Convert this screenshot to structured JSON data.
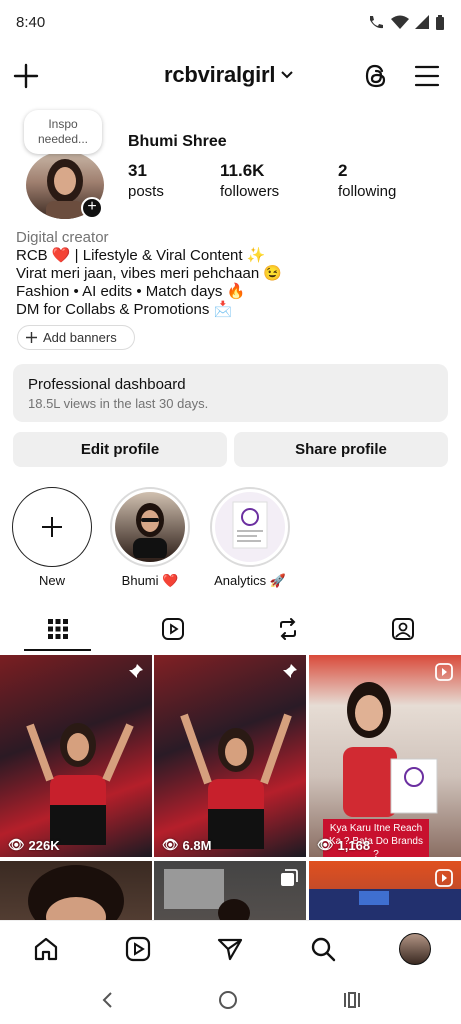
{
  "status_bar": {
    "time": "8:40"
  },
  "header": {
    "username": "rcbviralgirl"
  },
  "profile": {
    "note": "Inspo needed...",
    "display_name": "Bhumi Shree",
    "stats": [
      {
        "value": "31",
        "label": "posts"
      },
      {
        "value": "11.6K",
        "label": "followers"
      },
      {
        "value": "2",
        "label": "following"
      }
    ],
    "category": "Digital creator",
    "bio_lines": [
      "RCB ❤️ | Lifestyle & Viral Content ✨",
      "Virat meri jaan, vibes meri pehchaan 😉",
      "Fashion • AI edits • Match days 🔥",
      "DM for Collabs & Promotions 📩"
    ],
    "add_banners": "Add banners"
  },
  "dashboard": {
    "title": "Professional dashboard",
    "subtitle": "18.5L views in the last 30 days."
  },
  "buttons": {
    "edit": "Edit profile",
    "share": "Share profile"
  },
  "highlights": [
    {
      "label": "New"
    },
    {
      "label": "Bhumi ❤️"
    },
    {
      "label": "Analytics 🚀"
    }
  ],
  "grid": [
    {
      "views": "226K",
      "badge": "pin-icon"
    },
    {
      "views": "6.8M",
      "badge": "pin-icon"
    },
    {
      "views": "1,168",
      "badge": "reel-icon",
      "caption": "Kya Karu Itne Reach Ka ? Bata Do Brands ?"
    },
    {
      "views": "",
      "badge": ""
    },
    {
      "views": "",
      "badge": "carousel-icon"
    },
    {
      "views": "",
      "badge": "reel-icon"
    }
  ],
  "colors": {
    "accent": "#c8102e",
    "muted": "#737373",
    "button_bg": "#efefef"
  }
}
